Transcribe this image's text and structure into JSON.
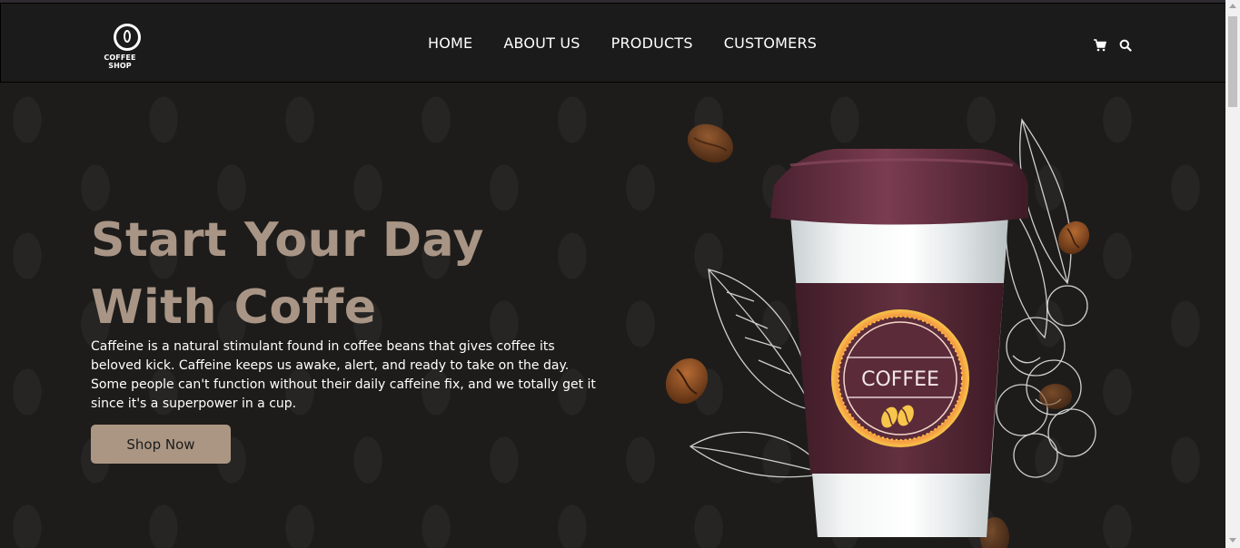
{
  "header": {
    "logo_text": "COFFEE SHOP",
    "nav": [
      "HOME",
      "ABOUT US",
      "PRODUCTS",
      "CUSTOMERS"
    ],
    "icons": [
      "cart-icon",
      "search-icon"
    ]
  },
  "hero": {
    "title_line1": "Start Your Day",
    "title_line2": "With Coffe",
    "description": "Caffeine is a natural stimulant found in coffee beans that gives coffee its beloved kick. Caffeine keeps us awake, alert, and ready to take on the day. Some people can't function without their daily caffeine fix, and we totally get it since it's a superpower in a cup.",
    "button_label": "Shop Now",
    "cup_label": "COFFEE"
  },
  "colors": {
    "background": "#1d1c1b",
    "header": "#1b1b1b",
    "accent": "#ab9683",
    "title": "#a99585",
    "cup_lid": "#5e2d3d",
    "cup_sleeve": "#5a2b3a"
  }
}
